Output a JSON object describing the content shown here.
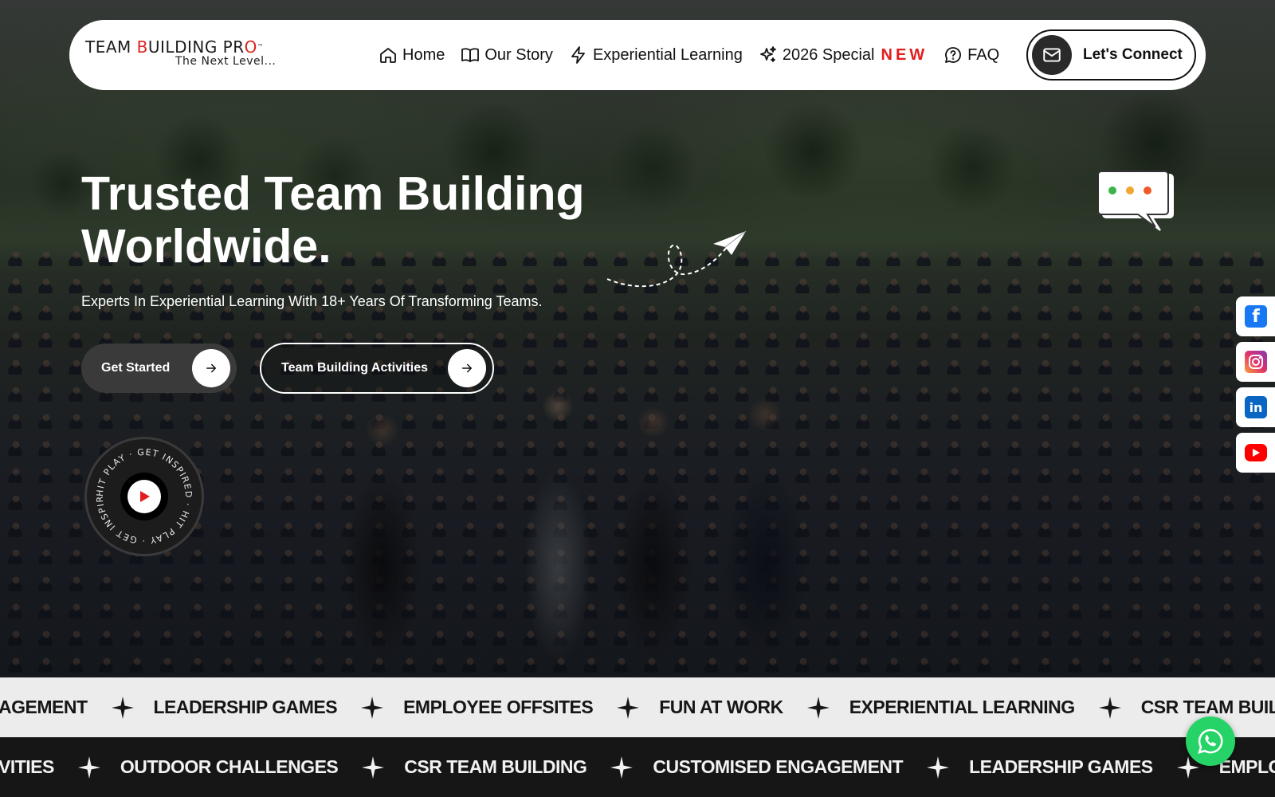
{
  "logo": {
    "main_part1": "TEAM ",
    "main_red": "B",
    "main_part2": "UILDING PR",
    "main_red2": "O",
    "tm": "™",
    "tagline": "The Next Level..."
  },
  "nav": {
    "items": [
      {
        "label": "Home",
        "icon": "home-icon"
      },
      {
        "label": "Our Story",
        "icon": "book-icon"
      },
      {
        "label": "Experiential Learning",
        "icon": "lightning-icon"
      },
      {
        "label": "2026 Special",
        "icon": "sparkle-icon",
        "badge": "NEW"
      },
      {
        "label": "FAQ",
        "icon": "question-chat-icon"
      }
    ],
    "connect_label": "Let's Connect"
  },
  "hero": {
    "title_line1": "Trusted Team Building",
    "title_line2": "Worldwide.",
    "subtitle": "Experts In Experiential Learning With 18+ Years Of Transforming Teams.",
    "primary_button": "Get Started",
    "secondary_button": "Team Building Activities",
    "play_ring_text": "HIT PLAY · GET INSPIRED · HIT PLAY · GET INSPIRED ·"
  },
  "social": [
    "facebook-icon",
    "instagram-icon",
    "linkedin-icon",
    "youtube-icon"
  ],
  "marquee_top": [
    "AGEMENT",
    "LEADERSHIP GAMES",
    "EMPLOYEE OFFSITES",
    "FUN AT WORK",
    "EXPERIENTIAL LEARNING",
    "CSR TEAM BUILDI"
  ],
  "marquee_bottom": [
    "VITIES",
    "OUTDOOR CHALLENGES",
    "CSR TEAM BUILDING",
    "CUSTOMISED ENGAGEMENT",
    "LEADERSHIP GAMES",
    "EMPLOY"
  ],
  "colors": {
    "brand_red": "#d9231d",
    "new_badge": "#e21d1d",
    "whatsapp": "#25d366",
    "marquee_light": "#ececec",
    "marquee_dark": "#161616"
  }
}
